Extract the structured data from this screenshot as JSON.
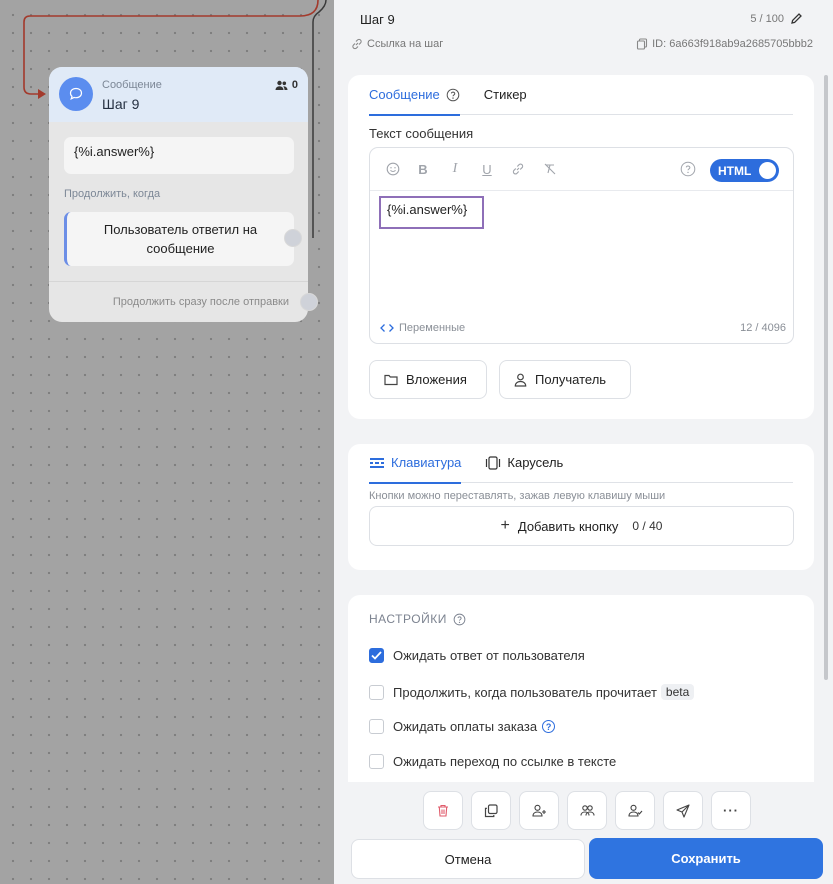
{
  "canvas": {
    "node": {
      "type_label": "Сообщение",
      "title": "Шаг 9",
      "users_count": "0",
      "message": "{%i.answer%}",
      "continue_label": "Продолжить, когда",
      "condition": "Пользователь ответил на сообщение",
      "after_send": "Продолжить сразу после отправки"
    }
  },
  "panel": {
    "step_title": "Шаг 9",
    "title_counter": "5 / 100",
    "step_link": "Ссылка на шаг",
    "step_id": "ID: 6a663f918ab9a2685705bbb2",
    "message_card": {
      "tabs": [
        "Сообщение",
        "Стикер"
      ],
      "text_label": "Текст сообщения",
      "html_toggle": "HTML",
      "editor_value": "{%i.answer%}",
      "variables_label": "Переменные",
      "char_count": "12 / 4096",
      "attachments_button": "Вложения",
      "recipient_button": "Получатель"
    },
    "keyboard_card": {
      "tabs": [
        "Клавиатура",
        "Карусель"
      ],
      "hint": "Кнопки можно переставлять, зажав левую клавишу мыши",
      "add_button": "Добавить кнопку",
      "add_count": "0 / 40"
    },
    "settings_card": {
      "heading": "НАСТРОЙКИ",
      "options": [
        {
          "label": "Ожидать ответ от пользователя",
          "checked": true
        },
        {
          "label": "Продолжить, когда пользователь прочитает",
          "badge": "beta",
          "checked": false
        },
        {
          "label": "Ожидать оплаты заказа",
          "checked": false
        },
        {
          "label": "Ожидать переход по ссылке в тексте",
          "checked": false
        }
      ]
    },
    "bottom": {
      "icons": [
        "trash-icon",
        "copy-icon",
        "add-user-icon",
        "users-icon",
        "user-check-icon",
        "send-icon",
        "more-icon"
      ],
      "cancel": "Отмена",
      "save": "Сохранить"
    }
  },
  "colors": {
    "accent": "#2d6ddd",
    "save_button": "#2f74e0",
    "node_avatar": "#5b8def",
    "editor_highlight": "#8e6fb8",
    "connector": "#a33a2c"
  }
}
